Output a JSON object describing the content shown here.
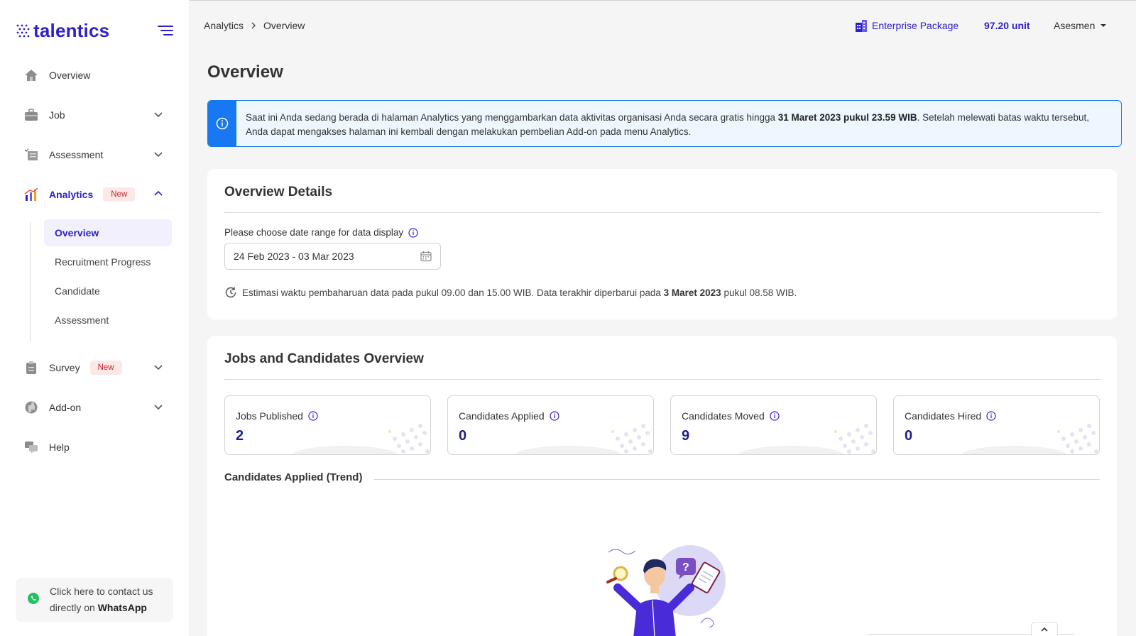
{
  "brand": {
    "name": "talentics"
  },
  "sidebar": {
    "items": [
      {
        "key": "overview",
        "label": "Overview",
        "icon": "home-icon"
      },
      {
        "key": "job",
        "label": "Job",
        "icon": "briefcase-icon"
      },
      {
        "key": "assessment",
        "label": "Assessment",
        "icon": "checklist-icon"
      },
      {
        "key": "analytics",
        "label": "Analytics",
        "icon": "bar-chart-icon",
        "badge": "New"
      },
      {
        "key": "survey",
        "label": "Survey",
        "icon": "clipboard-icon",
        "badge": "New"
      },
      {
        "key": "addon",
        "label": "Add-on",
        "icon": "puzzle-icon"
      },
      {
        "key": "help",
        "label": "Help",
        "icon": "chat-icon"
      }
    ],
    "analytics_sub": [
      "Overview",
      "Recruitment Progress",
      "Candidate",
      "Assessment"
    ],
    "whatsapp": {
      "line1": "Click here to contact us",
      "line2_prefix": "directly on ",
      "line2_bold": "WhatsApp"
    }
  },
  "topbar": {
    "breadcrumb": [
      "Analytics",
      "Overview"
    ],
    "package": "Enterprise Package",
    "units": "97.20 unit",
    "user": "Asesmen"
  },
  "page": {
    "title": "Overview"
  },
  "banner": {
    "text_1": "Saat ini Anda sedang berada di halaman Analytics yang menggambarkan data aktivitas organisasi Anda secara gratis hingga ",
    "bold": "31 Maret 2023 pukul 23.59 WIB",
    "text_2": ". Setelah melewati batas waktu tersebut, Anda dapat mengakses halaman ini kembali dengan melakukan pembelian Add-on pada menu Analytics."
  },
  "overview_details": {
    "title": "Overview Details",
    "date_label": "Please choose date range for data display",
    "date_value": "24 Feb 2023 - 03 Mar 2023",
    "estimate_1": "Estimasi waktu pembaharuan data pada pukul 09.00 dan 15.00 WIB. Data terakhir diperbarui pada ",
    "estimate_bold": "3 Maret 2023",
    "estimate_2": " pukul 08.58 WIB."
  },
  "jobs_overview": {
    "title": "Jobs and Candidates Overview",
    "stats": [
      {
        "label": "Jobs Published",
        "value": "2"
      },
      {
        "label": "Candidates Applied",
        "value": "0"
      },
      {
        "label": "Candidates Moved",
        "value": "9"
      },
      {
        "label": "Candidates Hired",
        "value": "0"
      }
    ],
    "trend_title": "Candidates Applied (Trend)"
  },
  "colors": {
    "brand": "#2e21c9",
    "info": "#1778f2",
    "value": "#1d1e8f",
    "badge_bg": "#fde8e8",
    "badge_text": "#c0282d"
  }
}
